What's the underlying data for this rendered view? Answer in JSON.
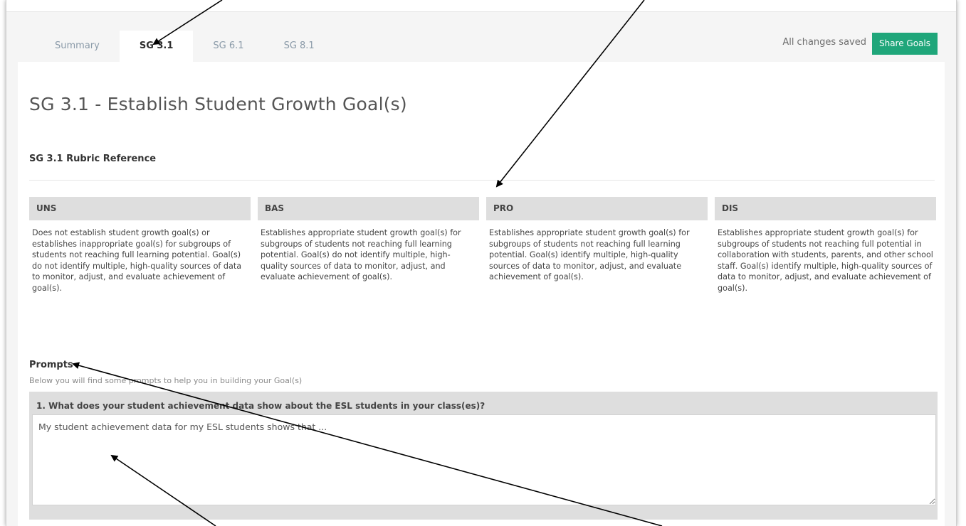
{
  "tabs": [
    {
      "label": "Summary",
      "active": false
    },
    {
      "label": "SG 3.1",
      "active": true
    },
    {
      "label": "SG 6.1",
      "active": false
    },
    {
      "label": "SG 8.1",
      "active": false
    }
  ],
  "header": {
    "save_status": "All changes saved",
    "share_label": "Share Goals"
  },
  "page": {
    "title": "SG 3.1 - Establish Student Growth Goal(s)",
    "rubric_heading": "SG 3.1 Rubric Reference"
  },
  "rubric": [
    {
      "level": "UNS",
      "text": "Does not establish student growth goal(s) or establishes inappropriate goal(s) for subgroups of students not reaching full learning potential. Goal(s) do not identify multiple, high-quality sources of data to monitor, adjust, and evaluate achievement of goal(s)."
    },
    {
      "level": "BAS",
      "text": "Establishes appropriate student growth goal(s) for subgroups of students not reaching full learning potential. Goal(s) do not identify multiple, high-quality sources of data to monitor, adjust, and evaluate achievement of goal(s)."
    },
    {
      "level": "PRO",
      "text": "Establishes appropriate student growth goal(s) for subgroups of students not reaching full learning potential. Goal(s) identify multiple, high-quality sources of data to monitor, adjust, and evaluate achievement of goal(s)."
    },
    {
      "level": "DIS",
      "text": "Establishes appropriate student growth goal(s) for subgroups of students not reaching full potential in collaboration with students, parents, and other school staff. Goal(s) identify multiple, high-quality sources of data to monitor, adjust, and evaluate achievement of goal(s)."
    }
  ],
  "prompts": {
    "heading": "Prompts",
    "subtitle": "Below you will find some prompts to help you in building your Goal(s)",
    "questions": [
      {
        "label": "1.   What does your student achievement data show about the ESL students in your class(es)?",
        "answer": "My student achievement data for my ESL students shows that ..."
      }
    ]
  },
  "colors": {
    "accent": "#1fa67a",
    "header_gray": "#dedede"
  }
}
